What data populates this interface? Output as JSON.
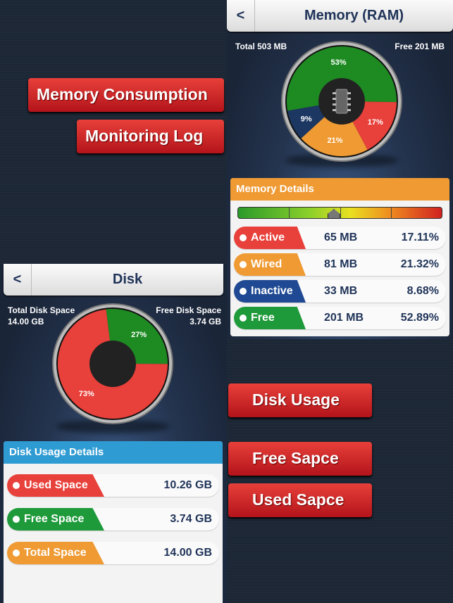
{
  "banners": {
    "memory_consumption": "Memory Consumption",
    "monitoring_log": "Monitoring Log",
    "disk_usage": "Disk Usage",
    "free_space": "Free Sapce",
    "used_space": "Used Sapce"
  },
  "memory": {
    "back": "<",
    "title": "Memory (RAM)",
    "total": "Total 503 MB",
    "free": "Free 201 MB",
    "chip_label": "RAM",
    "details_title": "Memory Details",
    "gauge_level_percent": 47,
    "rows": [
      {
        "label": "Active",
        "mb": "65 MB",
        "pct": "17.11%",
        "color": "#e8403a"
      },
      {
        "label": "Wired",
        "mb": "81 MB",
        "pct": "21.32%",
        "color": "#ef9a33"
      },
      {
        "label": "Inactive",
        "mb": "33 MB",
        "pct": "8.68%",
        "color": "#1f4a93"
      },
      {
        "label": "Free",
        "mb": "201 MB",
        "pct": "52.89%",
        "color": "#1e9a3a"
      }
    ],
    "slices": [
      {
        "label": "53%",
        "value": 53,
        "color": "#1e8a22"
      },
      {
        "label": "17%",
        "value": 17,
        "color": "#e8403a"
      },
      {
        "label": "21%",
        "value": 21,
        "color": "#ef9a33"
      },
      {
        "label": "9%",
        "value": 9,
        "color": "#1c3761"
      }
    ]
  },
  "disk": {
    "back": "<",
    "title": "Disk",
    "total_label": "Total Disk Space",
    "total_value": "14.00 GB",
    "free_label": "Free Disk Space",
    "free_value": "3.74 GB",
    "details_title": "Disk Usage Details",
    "rows": [
      {
        "label": "Used Space",
        "value": "10.26 GB",
        "color": "#e8403a"
      },
      {
        "label": "Free Space",
        "value": "3.74 GB",
        "color": "#1e9a3a"
      },
      {
        "label": "Total Space",
        "value": "14.00 GB",
        "color": "#ef9a33"
      }
    ],
    "slices": [
      {
        "label": "27%",
        "value": 27,
        "color": "#1e8a22"
      },
      {
        "label": "73%",
        "value": 73,
        "color": "#e8403a"
      }
    ]
  }
}
